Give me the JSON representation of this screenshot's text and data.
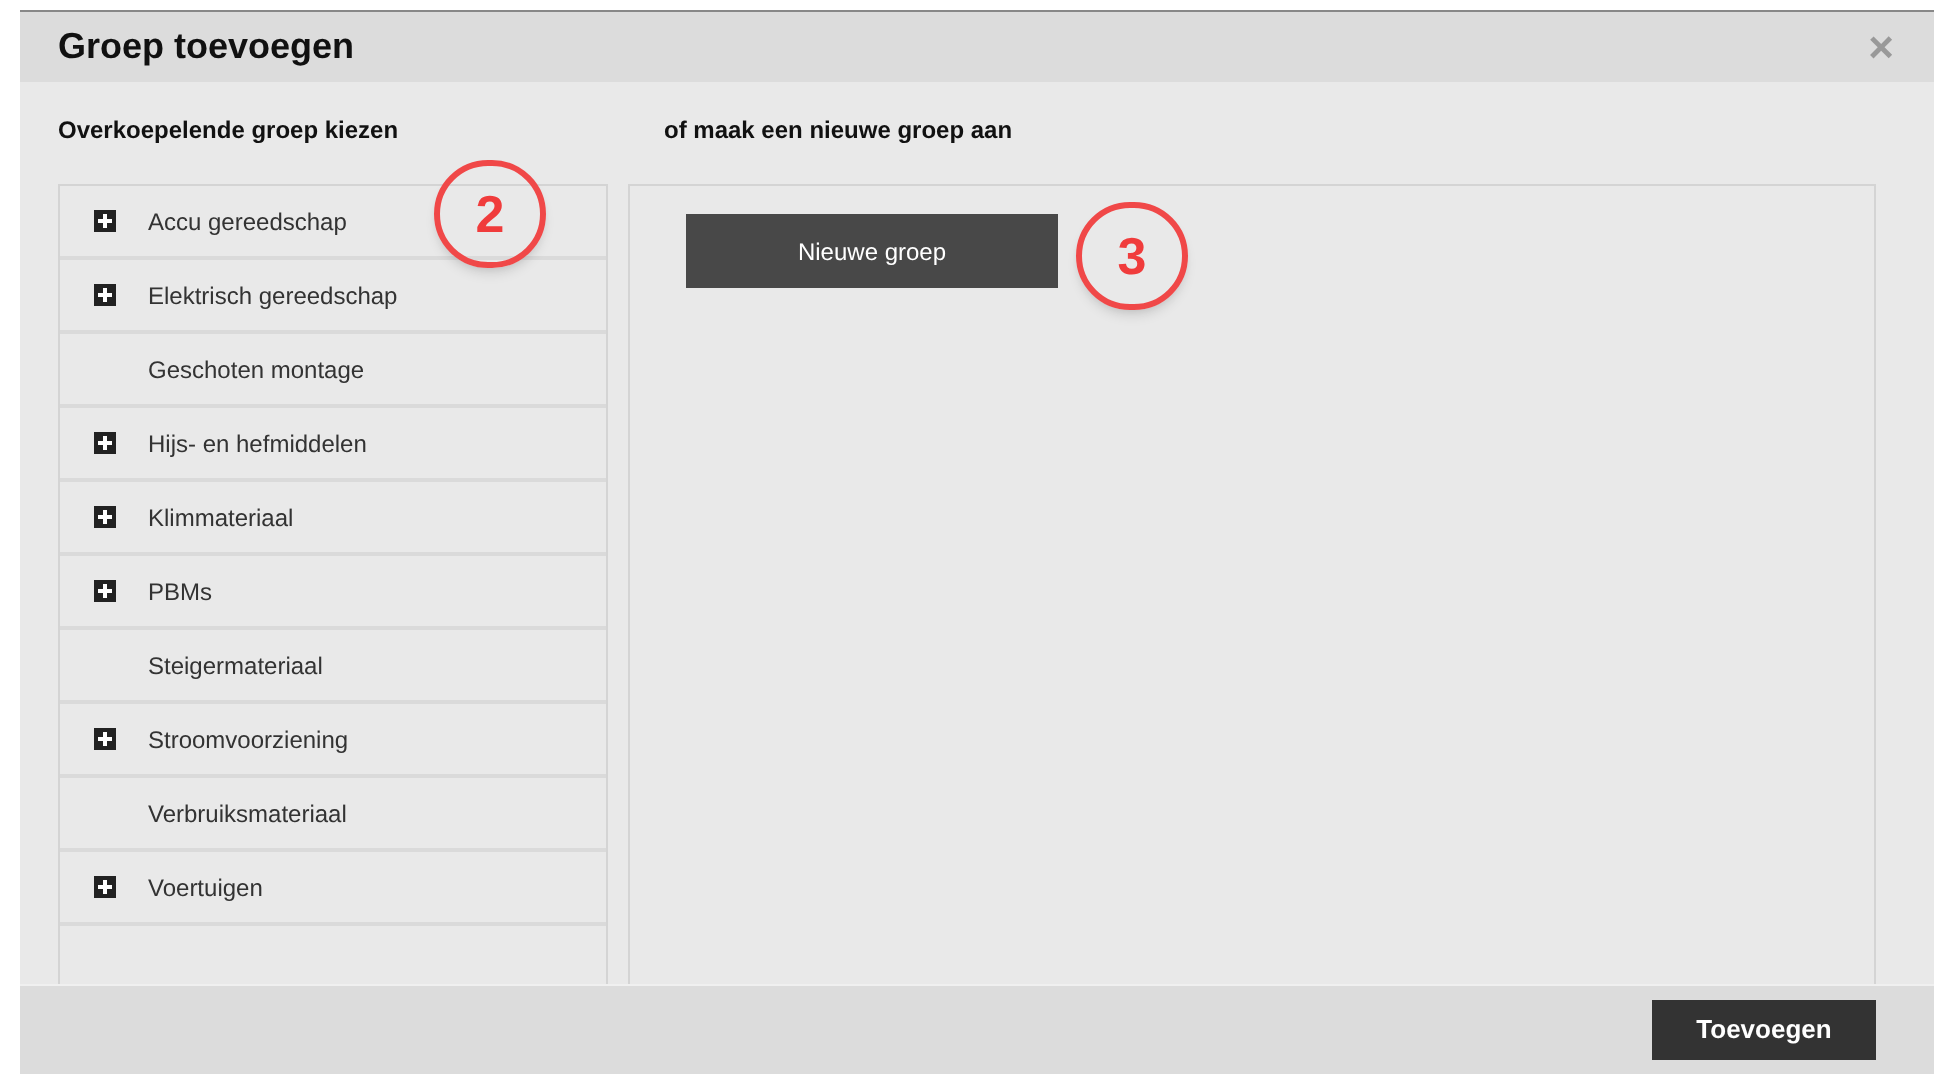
{
  "dialog": {
    "title": "Groep toevoegen",
    "close": "×"
  },
  "left": {
    "heading": "Overkoepelende groep kiezen",
    "items": [
      {
        "label": "Accu gereedschap",
        "expandable": true
      },
      {
        "label": "Elektrisch gereedschap",
        "expandable": true
      },
      {
        "label": "Geschoten montage",
        "expandable": false
      },
      {
        "label": "Hijs- en hefmiddelen",
        "expandable": true
      },
      {
        "label": "Klimmateriaal",
        "expandable": true
      },
      {
        "label": "PBMs",
        "expandable": true
      },
      {
        "label": "Steigermateriaal",
        "expandable": false
      },
      {
        "label": "Stroomvoorziening",
        "expandable": true
      },
      {
        "label": "Verbruiksmateriaal",
        "expandable": false
      },
      {
        "label": "Voertuigen",
        "expandable": true
      }
    ]
  },
  "right": {
    "heading": "of maak een nieuwe groep aan",
    "button": "Nieuwe groep"
  },
  "annotations": [
    "2",
    "3"
  ],
  "footer": {
    "button": "Toevoegen"
  }
}
